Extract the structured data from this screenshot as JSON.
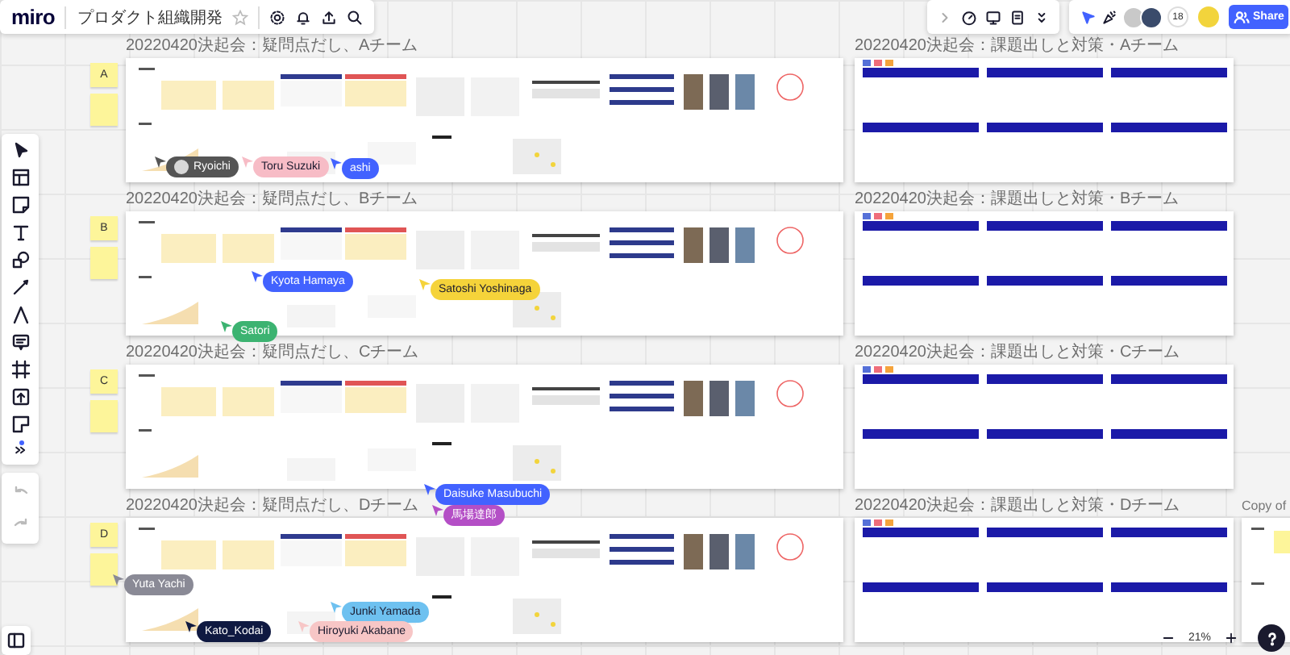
{
  "app": {
    "logo": "miro",
    "board_name": "プロダクト組織開発",
    "starred": false
  },
  "collaborators": {
    "count": "18"
  },
  "share": "Share",
  "rows": [
    {
      "sticky": "A",
      "left_title": "20220420決起会：疑問点だし、Aチーム",
      "right_title": "20220420決起会：課題出しと対策・Aチーム"
    },
    {
      "sticky": "B",
      "left_title": "20220420決起会：疑問点だし、Bチーム",
      "right_title": "20220420決起会：課題出しと対策・Bチーム"
    },
    {
      "sticky": "C",
      "left_title": "20220420決起会：疑問点だし、Cチーム",
      "right_title": "20220420決起会：課題出しと対策・Cチーム"
    },
    {
      "sticky": "D",
      "left_title": "20220420決起会：疑問点だし、Dチーム",
      "right_title": "20220420決起会：課題出しと対策・Dチーム"
    }
  ],
  "copy_frame_title": "Copy of",
  "cursors": [
    {
      "name": "Ryoichi",
      "color": "#555555"
    },
    {
      "name": "Toru Suzuki",
      "color": "#f7bcc6"
    },
    {
      "name": "ashi",
      "color": "#4262ff"
    },
    {
      "name": "Kyota Hamaya",
      "color": "#4262ff"
    },
    {
      "name": "Satoshi Yoshinaga",
      "color": "#f5d33a"
    },
    {
      "name": "Satori",
      "color": "#3cb371"
    },
    {
      "name": "Daisuke Masubuchi",
      "color": "#4262ff"
    },
    {
      "name": "馬場達郎",
      "color": "#b44fc6"
    },
    {
      "name": "Yuta Yachi",
      "color": "#8a8a96"
    },
    {
      "name": "Junki Yamada",
      "color": "#6ec1f0"
    },
    {
      "name": "Kato_Kodai",
      "color": "#0f1941"
    },
    {
      "name": "Hiroyuki Akabane",
      "color": "#f7c6c6"
    }
  ],
  "zoom": "21%"
}
